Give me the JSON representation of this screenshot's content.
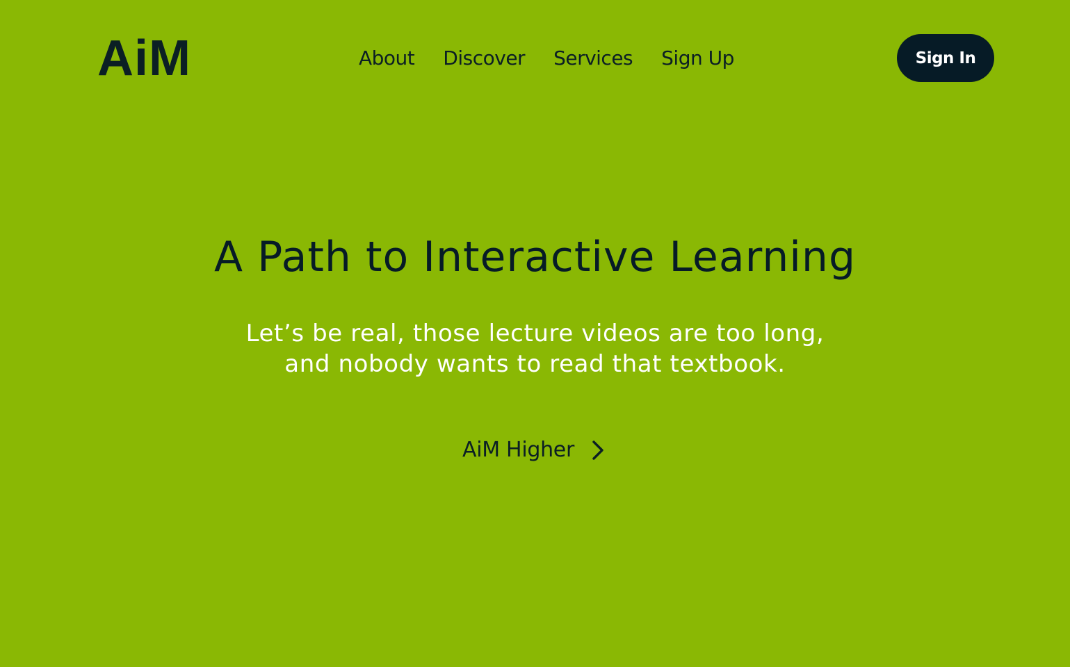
{
  "header": {
    "logo": "AiM",
    "nav": [
      {
        "label": "About"
      },
      {
        "label": "Discover"
      },
      {
        "label": "Services"
      },
      {
        "label": "Sign Up"
      }
    ],
    "signin_label": "Sign In"
  },
  "hero": {
    "title": "A Path to Interactive Learning",
    "subtitle_lines": [
      "Let’s be real, those lecture videos are too long,",
      "and nobody wants to read that textbook."
    ],
    "cta_label": "AiM Higher",
    "cta_icon": "chevron-right-icon"
  },
  "colors": {
    "background": "#8ab804",
    "text_dark": "#0b1f24",
    "button_bg": "#061b26",
    "button_text": "#ffffff",
    "subtitle_text": "#ffffff"
  }
}
